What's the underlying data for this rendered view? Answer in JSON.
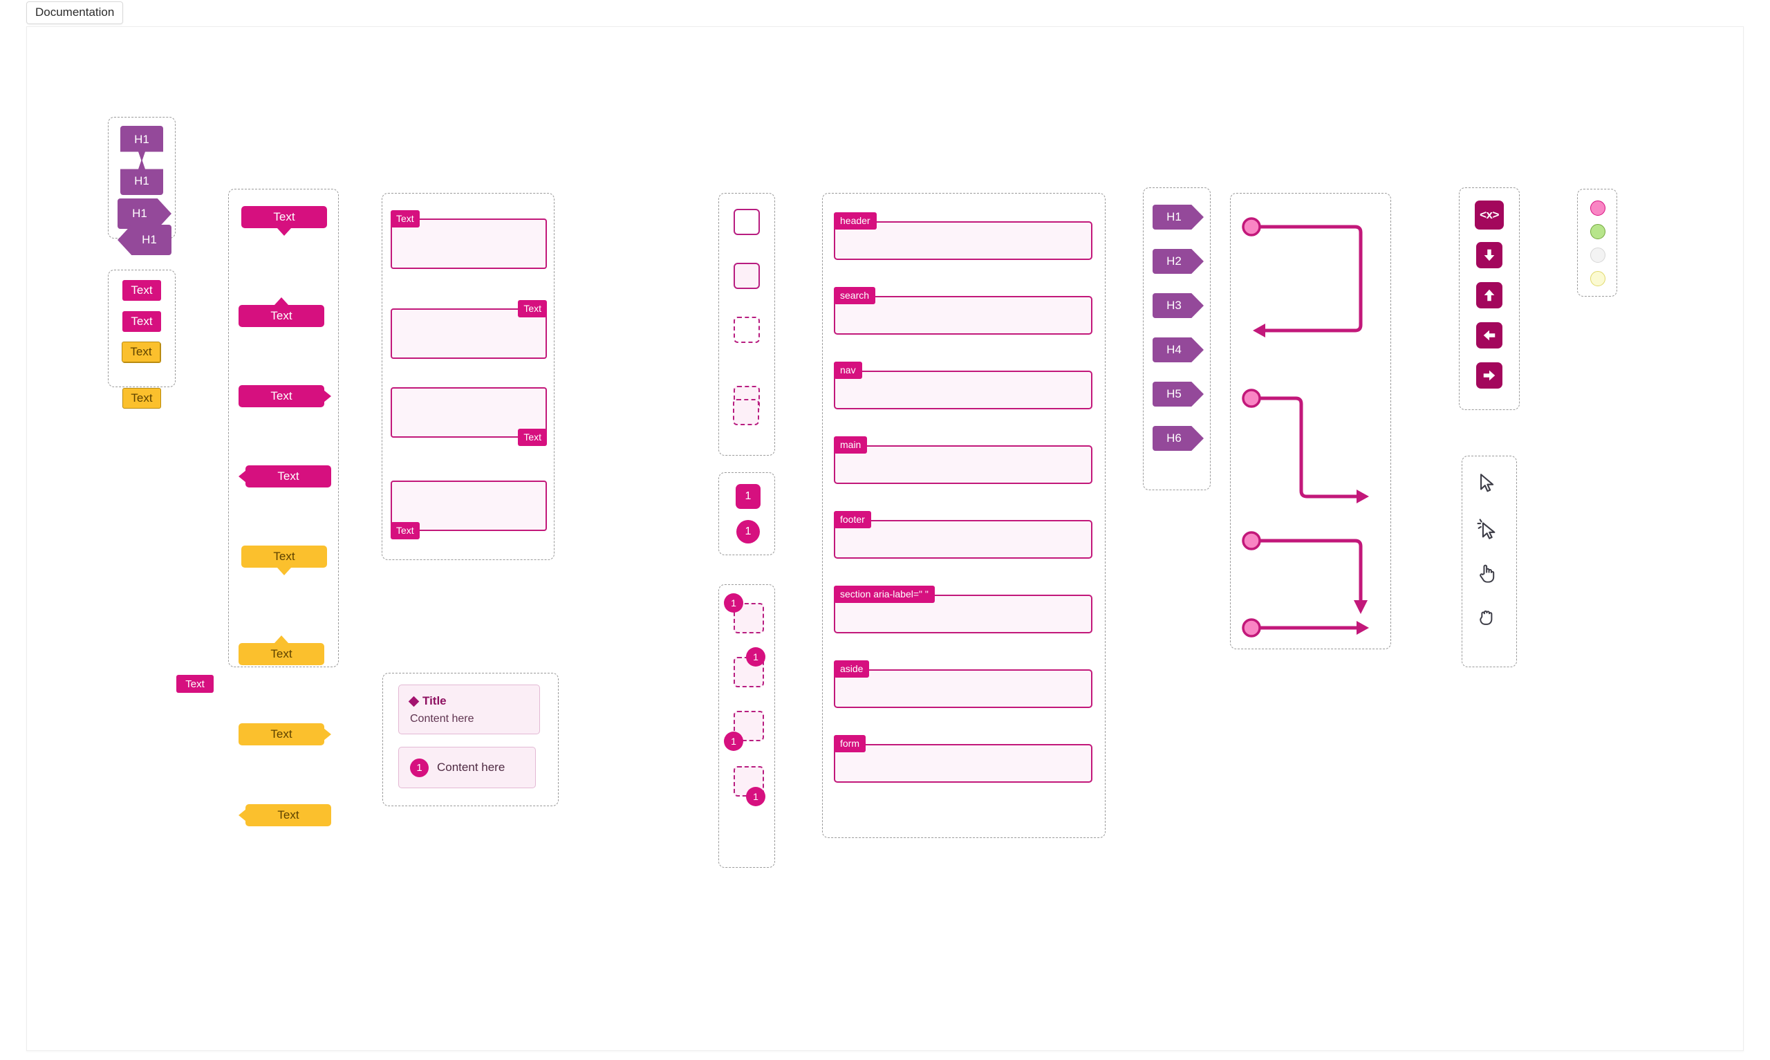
{
  "tabs": [
    {
      "label": "Documentation"
    }
  ],
  "groups": {
    "heading_shapes": {
      "items": [
        {
          "label": "H1",
          "direction": "down"
        },
        {
          "label": "H1",
          "direction": "up"
        },
        {
          "label": "H1",
          "direction": "right"
        },
        {
          "label": "H1",
          "direction": "left"
        }
      ]
    },
    "text_chips": {
      "items": [
        {
          "label": "Text",
          "color": "#d6107f",
          "style": "pink"
        },
        {
          "label": "Text",
          "color": "#d6107f",
          "style": "pink"
        },
        {
          "label": "Text",
          "color": "#fbc02d",
          "style": "yellow"
        },
        {
          "label": "Text",
          "color": "#fbc02d",
          "style": "yellow"
        }
      ]
    },
    "standalone_chip": {
      "label": "Text",
      "color": "#d6107f"
    },
    "callouts": {
      "items": [
        {
          "label": "Text",
          "style": "pink",
          "pointer": "down"
        },
        {
          "label": "Text",
          "style": "pink",
          "pointer": "up"
        },
        {
          "label": "Text",
          "style": "pink",
          "pointer": "right"
        },
        {
          "label": "Text",
          "style": "pink",
          "pointer": "left"
        },
        {
          "label": "Text",
          "style": "yellow",
          "pointer": "down"
        },
        {
          "label": "Text",
          "style": "yellow",
          "pointer": "up"
        },
        {
          "label": "Text",
          "style": "yellow",
          "pointer": "right"
        },
        {
          "label": "Text",
          "style": "yellow",
          "pointer": "left"
        }
      ]
    },
    "tagged_boxes": {
      "items": [
        {
          "label": "Text",
          "tag_position": "top-left"
        },
        {
          "label": "Text",
          "tag_position": "top-right"
        },
        {
          "label": "Text",
          "tag_position": "bottom-right"
        },
        {
          "label": "Text",
          "tag_position": "bottom-left"
        }
      ]
    },
    "note_cards": {
      "title_card": {
        "title": "Title",
        "body": "Content here"
      },
      "numbered_card": {
        "number": "1",
        "body": "Content here"
      }
    },
    "squares": {
      "items": [
        {
          "border": "solid",
          "fill": "white"
        },
        {
          "border": "solid",
          "fill": "pink"
        },
        {
          "border": "dashed",
          "fill": "white"
        },
        {
          "border": "dashed",
          "fill": "pink"
        }
      ]
    },
    "number_badges": {
      "items": [
        {
          "label": "1",
          "shape": "rounded-square"
        },
        {
          "label": "1",
          "shape": "circle"
        }
      ]
    },
    "badged_squares": {
      "items": [
        {
          "label": "1",
          "badge_position": "top-left"
        },
        {
          "label": "1",
          "badge_position": "top-right"
        },
        {
          "label": "1",
          "badge_position": "bottom-left"
        },
        {
          "label": "1",
          "badge_position": "bottom-right"
        }
      ]
    },
    "landmarks": {
      "items": [
        {
          "label": "header"
        },
        {
          "label": "search"
        },
        {
          "label": "nav"
        },
        {
          "label": "main"
        },
        {
          "label": "footer"
        },
        {
          "label": "section aria-label=\"  \""
        },
        {
          "label": "aside"
        },
        {
          "label": "form"
        }
      ]
    },
    "heading_levels": {
      "items": [
        {
          "label": "H1"
        },
        {
          "label": "H2"
        },
        {
          "label": "H3"
        },
        {
          "label": "H4"
        },
        {
          "label": "H5"
        },
        {
          "label": "H6"
        }
      ]
    },
    "connectors": {
      "items": [
        {
          "shape": "right-down-left",
          "end": "arrow-left"
        },
        {
          "shape": "right-down-right",
          "end": "arrow-right"
        },
        {
          "shape": "right-down",
          "end": "arrow-down"
        },
        {
          "shape": "straight-right",
          "end": "arrow-right"
        }
      ],
      "stroke_color": "#c2187a",
      "node_fill": "#f985c4"
    },
    "toolbar": {
      "items": [
        {
          "label": "<x>",
          "icon": "code-tag-icon"
        },
        {
          "label": "",
          "icon": "arrow-down-icon"
        },
        {
          "label": "",
          "icon": "arrow-up-icon"
        },
        {
          "label": "",
          "icon": "arrow-left-icon"
        },
        {
          "label": "",
          "icon": "arrow-right-icon"
        }
      ],
      "button_color": "#a3075c"
    },
    "cursors": {
      "items": [
        {
          "icon": "cursor-arrow-icon"
        },
        {
          "icon": "cursor-click-icon"
        },
        {
          "icon": "hand-pointing-icon"
        },
        {
          "icon": "hand-grab-icon"
        }
      ]
    },
    "status_dots": {
      "items": [
        {
          "color": "#f985c4",
          "style": "pink"
        },
        {
          "color": "#b7e58b",
          "style": "green"
        },
        {
          "color": "#f3f3f3",
          "style": "gray"
        },
        {
          "color": "#fbfad2",
          "style": "yellow"
        }
      ]
    }
  }
}
